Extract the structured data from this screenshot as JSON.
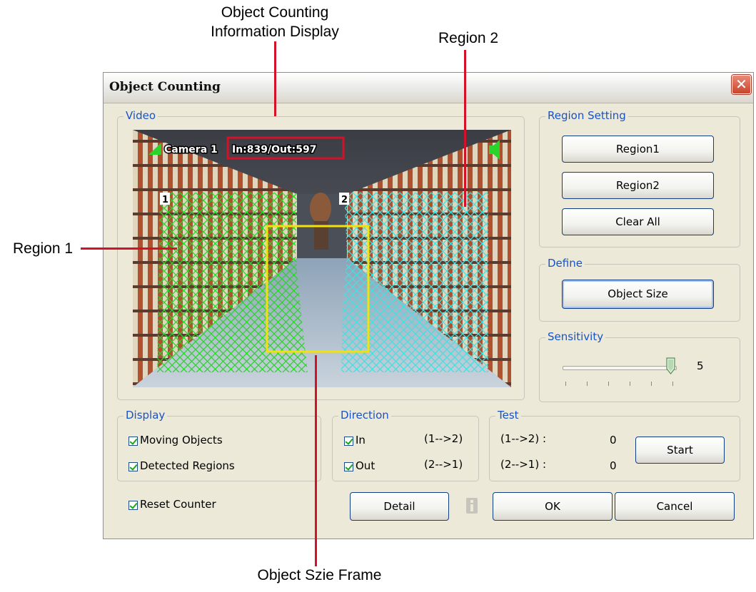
{
  "callouts": {
    "info_display_line1": "Object Counting",
    "info_display_line2": "Information Display",
    "region2": "Region 2",
    "region1": "Region 1",
    "size_frame": "Object Szie Frame"
  },
  "dialog": {
    "title": "Object Counting",
    "close_glyph": "✕"
  },
  "video": {
    "label": "Video",
    "overlay_camera": "Camera 1",
    "overlay_counts": "In:839/Out:597",
    "region1_marker": "1",
    "region2_marker": "2"
  },
  "region_setting": {
    "label": "Region Setting",
    "region1_button": "Region1",
    "region2_button": "Region2",
    "clear_all_button": "Clear All"
  },
  "define": {
    "label": "Define",
    "object_size_button": "Object Size"
  },
  "sensitivity": {
    "label": "Sensitivity",
    "value": "5",
    "level": 5,
    "max": 5
  },
  "display": {
    "label": "Display",
    "moving_objects": "Moving Objects",
    "detected_regions": "Detected Regions"
  },
  "direction": {
    "label": "Direction",
    "in_label": "In",
    "in_mapping": "(1-->2)",
    "out_label": "Out",
    "out_mapping": "(2-->1)"
  },
  "test": {
    "label": "Test",
    "row1_label": "(1-->2) :",
    "row1_value": "0",
    "row2_label": "(2-->1) :",
    "row2_value": "0",
    "start_button": "Start"
  },
  "bottom": {
    "reset_counter": "Reset Counter",
    "detail_button": "Detail",
    "ok_button": "OK",
    "cancel_button": "Cancel",
    "info_icon": "info-icon"
  },
  "colors": {
    "callout_line": "#d3122a",
    "legend_text": "#1653c8",
    "region1_hatch": "#2bd42b",
    "region2_hatch": "#43e0e0",
    "size_frame": "#f2e20a"
  }
}
